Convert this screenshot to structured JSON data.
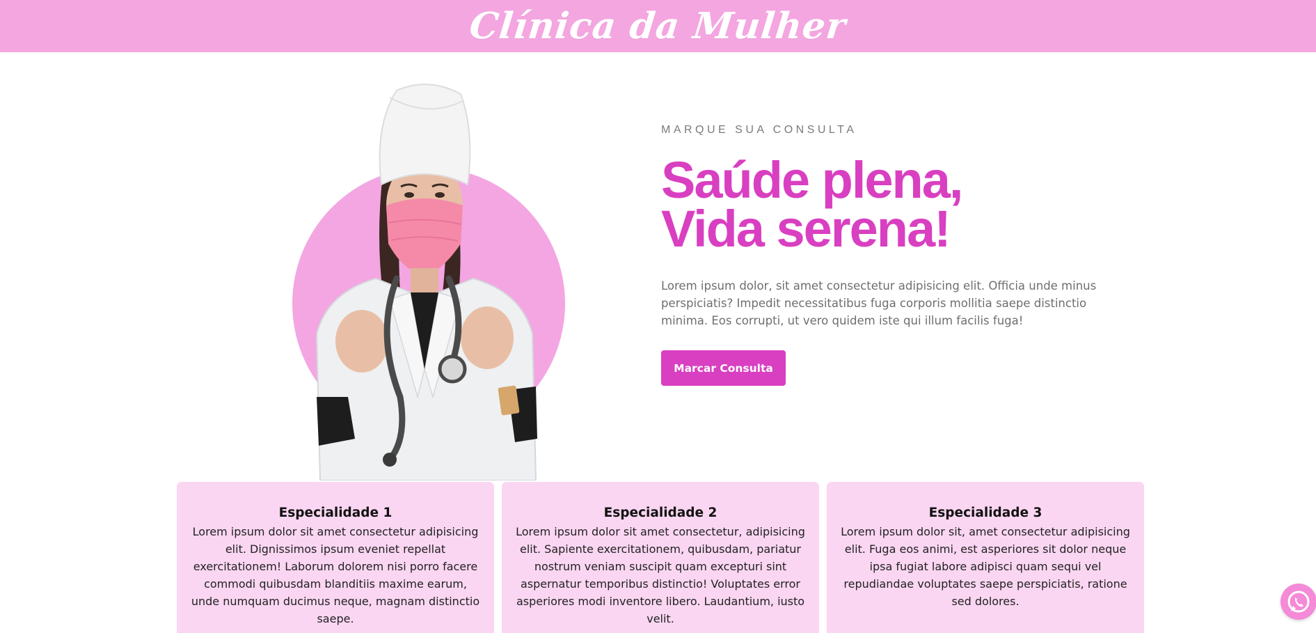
{
  "header": {
    "brand": "Clínica da Mulher"
  },
  "hero": {
    "eyebrow": "MARQUE SUA CONSULTA",
    "headline_line1": "Saúde plena,",
    "headline_line2": "Vida serena!",
    "lead": "Lorem ipsum dolor, sit amet consectetur adipisicing elit. Officia unde minus perspiciatis? Impedit necessitatibus fuga corporis mollitia saepe distinctio minima. Eos corrupti, ut vero quidem iste qui illum facilis fuga!",
    "cta_label": "Marcar Consulta"
  },
  "cards": [
    {
      "title": "Especialidade 1",
      "text": "Lorem ipsum dolor sit amet consectetur adipisicing elit. Dignissimos ipsum eveniet repellat exercitationem! Laborum dolorem nisi porro facere commodi quibusdam blanditiis maxime earum, unde numquam ducimus neque, magnam distinctio saepe."
    },
    {
      "title": "Especialidade 2",
      "text": "Lorem ipsum dolor sit amet consectetur, adipisicing elit. Sapiente exercitationem, quibusdam, pariatur nostrum veniam suscipit quam excepturi sint aspernatur temporibus distinctio! Voluptates error asperiores modi inventore libero. Laudantium, iusto velit."
    },
    {
      "title": "Especialidade 3",
      "text": "Lorem ipsum dolor sit, amet consectetur adipisicing elit. Fuga eos animi, est asperiores sit dolor neque ipsa fugiat labore adipisci quam sequi vel repudiandae voluptates saepe perspiciatis, ratione sed dolores."
    }
  ],
  "floating": {
    "icon": "whatsapp-icon"
  },
  "colors": {
    "header_bg": "#f4a6e0",
    "accent": "#d93fc1",
    "card_bg": "#fad6f2",
    "circle": "#f3a6e2"
  },
  "image": {
    "subject": "doctor-photo"
  }
}
